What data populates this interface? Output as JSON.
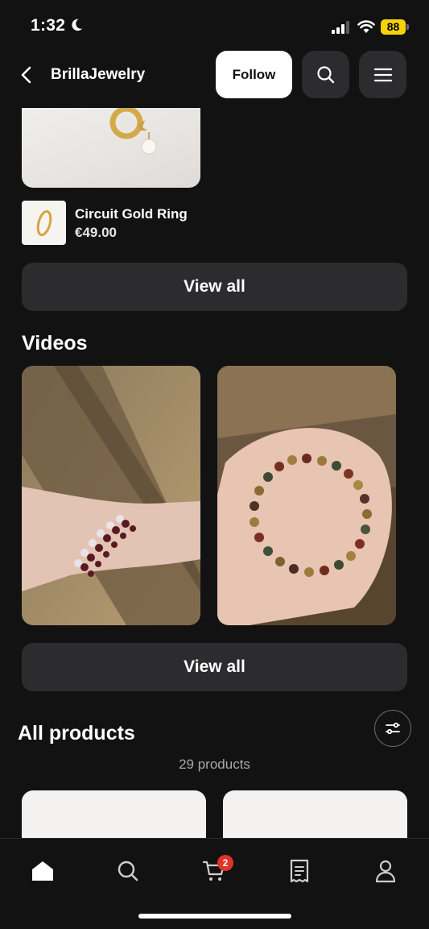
{
  "status_bar": {
    "time": "1:32",
    "battery": "88"
  },
  "header": {
    "back_icon": "chevron-left-icon",
    "shop_name": "BrillaJewelry",
    "follow_label": "Follow",
    "search_icon": "search-icon",
    "menu_icon": "hamburger-menu-icon"
  },
  "featured": {
    "product_name": "Circuit Gold Ring",
    "price": "€49.00",
    "view_all_label": "View all"
  },
  "videos": {
    "title": "Videos",
    "view_all_label": "View all"
  },
  "all_products": {
    "title": "All products",
    "count": "29 products",
    "filter_icon": "sliders-icon"
  },
  "tab_bar": {
    "items": [
      {
        "icon": "home-icon"
      },
      {
        "icon": "search-icon"
      },
      {
        "icon": "cart-icon",
        "badge": "2"
      },
      {
        "icon": "receipt-icon"
      },
      {
        "icon": "user-icon"
      }
    ]
  },
  "colors": {
    "background": "#121212",
    "surface": "#2c2c2e",
    "badge": "#e0342b",
    "battery": "#f5d20a"
  }
}
